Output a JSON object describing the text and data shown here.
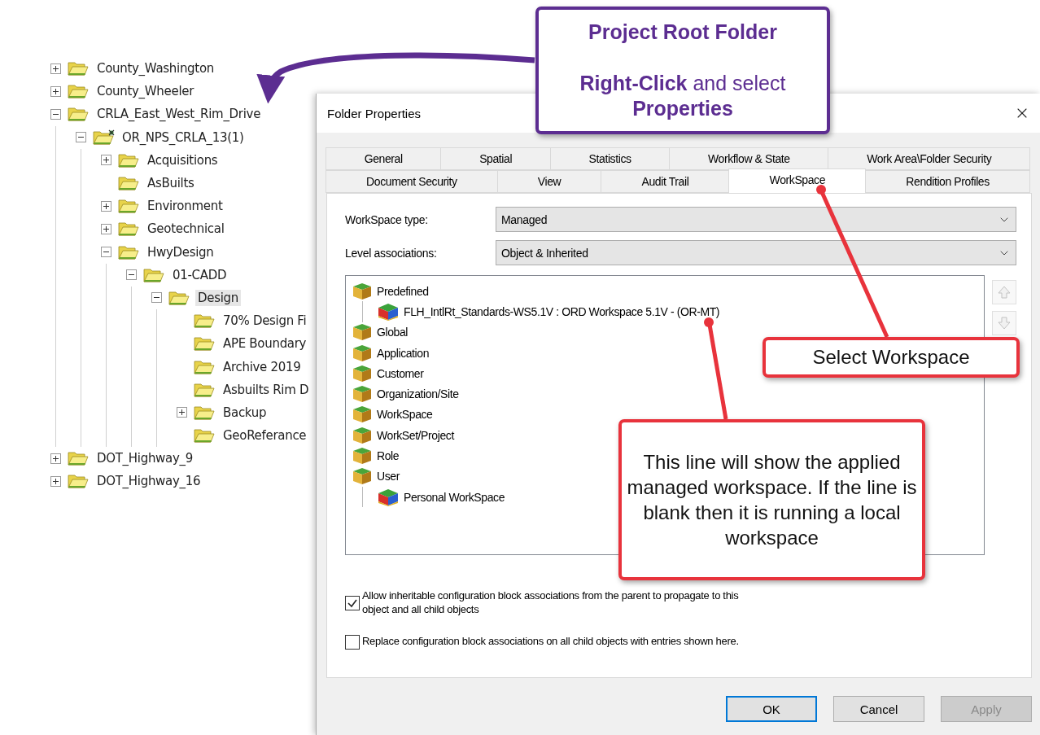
{
  "tree": {
    "items": [
      {
        "label": "County_Washington",
        "kind": "folder",
        "expanded": false,
        "selected": false
      },
      {
        "label": "County_Wheeler",
        "kind": "folder",
        "expanded": false,
        "selected": false
      },
      {
        "label": "CRLA_East_West_Rim_Drive",
        "kind": "folder",
        "expanded": true,
        "selected": false,
        "children": [
          {
            "label": "OR_NPS_CRLA_13(1)",
            "kind": "project",
            "expanded": true,
            "selected": false,
            "children": [
              {
                "label": "Acquisitions",
                "kind": "folder",
                "expanded": false,
                "selected": false
              },
              {
                "label": "AsBuilts",
                "kind": "folder",
                "selected": false
              },
              {
                "label": "Environment",
                "kind": "folder",
                "expanded": false,
                "selected": false
              },
              {
                "label": "Geotechnical",
                "kind": "folder",
                "expanded": false,
                "selected": false
              },
              {
                "label": "HwyDesign",
                "kind": "folder",
                "expanded": true,
                "selected": false,
                "children": [
                  {
                    "label": "01-CADD",
                    "kind": "folder",
                    "expanded": true,
                    "selected": false,
                    "children": [
                      {
                        "label": "Design",
                        "kind": "folder",
                        "expanded": true,
                        "selected": true,
                        "children": [
                          {
                            "label": "70% Design Fi",
                            "kind": "folder",
                            "selected": false
                          },
                          {
                            "label": "APE Boundary",
                            "kind": "folder",
                            "selected": false
                          },
                          {
                            "label": "Archive 2019",
                            "kind": "folder",
                            "selected": false
                          },
                          {
                            "label": "Asbuilts Rim D",
                            "kind": "folder",
                            "selected": false
                          },
                          {
                            "label": "Backup",
                            "kind": "folder",
                            "expanded": false,
                            "selected": false
                          },
                          {
                            "label": "GeoReferance",
                            "kind": "folder",
                            "selected": false
                          }
                        ]
                      }
                    ]
                  }
                ]
              }
            ]
          }
        ]
      },
      {
        "label": "DOT_Highway_9",
        "kind": "folder",
        "expanded": false,
        "selected": false
      },
      {
        "label": "DOT_Highway_16",
        "kind": "folder",
        "expanded": false,
        "selected": false
      }
    ]
  },
  "dialog": {
    "title": "Folder Properties",
    "tab_rows": [
      [
        {
          "label": "General",
          "selected": false
        },
        {
          "label": "Spatial",
          "selected": false
        },
        {
          "label": "Statistics",
          "selected": false
        },
        {
          "label": "Workflow & State",
          "selected": false
        },
        {
          "label": "Work Area\\Folder Security",
          "selected": false
        }
      ],
      [
        {
          "label": "Document Security",
          "selected": false
        },
        {
          "label": "View",
          "selected": false
        },
        {
          "label": "Audit Trail",
          "selected": false
        },
        {
          "label": "WorkSpace",
          "selected": true
        },
        {
          "label": "Rendition Profiles",
          "selected": false
        }
      ]
    ],
    "fields": [
      {
        "label": "WorkSpace type:",
        "value": "Managed"
      },
      {
        "label": "Level associations:",
        "value": "Object & Inherited"
      }
    ],
    "configuration_list": [
      {
        "label": "Predefined",
        "kind": "level",
        "children": [
          {
            "label": "FLH_IntlRt_Standards-WS5.1V : ORD Workspace 5.1V - (OR-MT)",
            "kind": "block"
          }
        ]
      },
      {
        "label": "Global",
        "kind": "level"
      },
      {
        "label": "Application",
        "kind": "level"
      },
      {
        "label": "Customer",
        "kind": "level"
      },
      {
        "label": "Organization/Site",
        "kind": "level"
      },
      {
        "label": "WorkSpace",
        "kind": "level"
      },
      {
        "label": "WorkSet/Project",
        "kind": "level"
      },
      {
        "label": "Role",
        "kind": "level"
      },
      {
        "label": "User",
        "kind": "level",
        "children": [
          {
            "label": "Personal WorkSpace",
            "kind": "block"
          }
        ]
      }
    ],
    "order_buttons": [
      {
        "kind": "up",
        "disabled": true
      },
      {
        "kind": "down",
        "disabled": true
      }
    ],
    "checkboxes": [
      {
        "label": "Allow inheritable configuration block associations from the parent to propagate to this object and all child objects",
        "checked": true
      },
      {
        "label": "Replace configuration block associations on all child objects with entries shown here.",
        "checked": false
      }
    ],
    "buttons": [
      {
        "label": "OK",
        "default": true,
        "disabled": false
      },
      {
        "label": "Cancel",
        "default": false,
        "disabled": false
      },
      {
        "label": "Apply",
        "default": false,
        "disabled": true
      }
    ]
  },
  "callouts": [
    {
      "kind": "title",
      "color": "#5c2d91",
      "lines": [
        "**Project Root Folder**",
        "**Right-Click** and select",
        "**Properties**"
      ]
    },
    {
      "kind": "note",
      "color": "#e8333c",
      "lines": [
        "Select Workspace"
      ]
    },
    {
      "kind": "note",
      "color": "#e8333c",
      "lines": [
        "This line will show the applied managed workspace. If the line is blank then it is running a local workspace"
      ]
    }
  ]
}
